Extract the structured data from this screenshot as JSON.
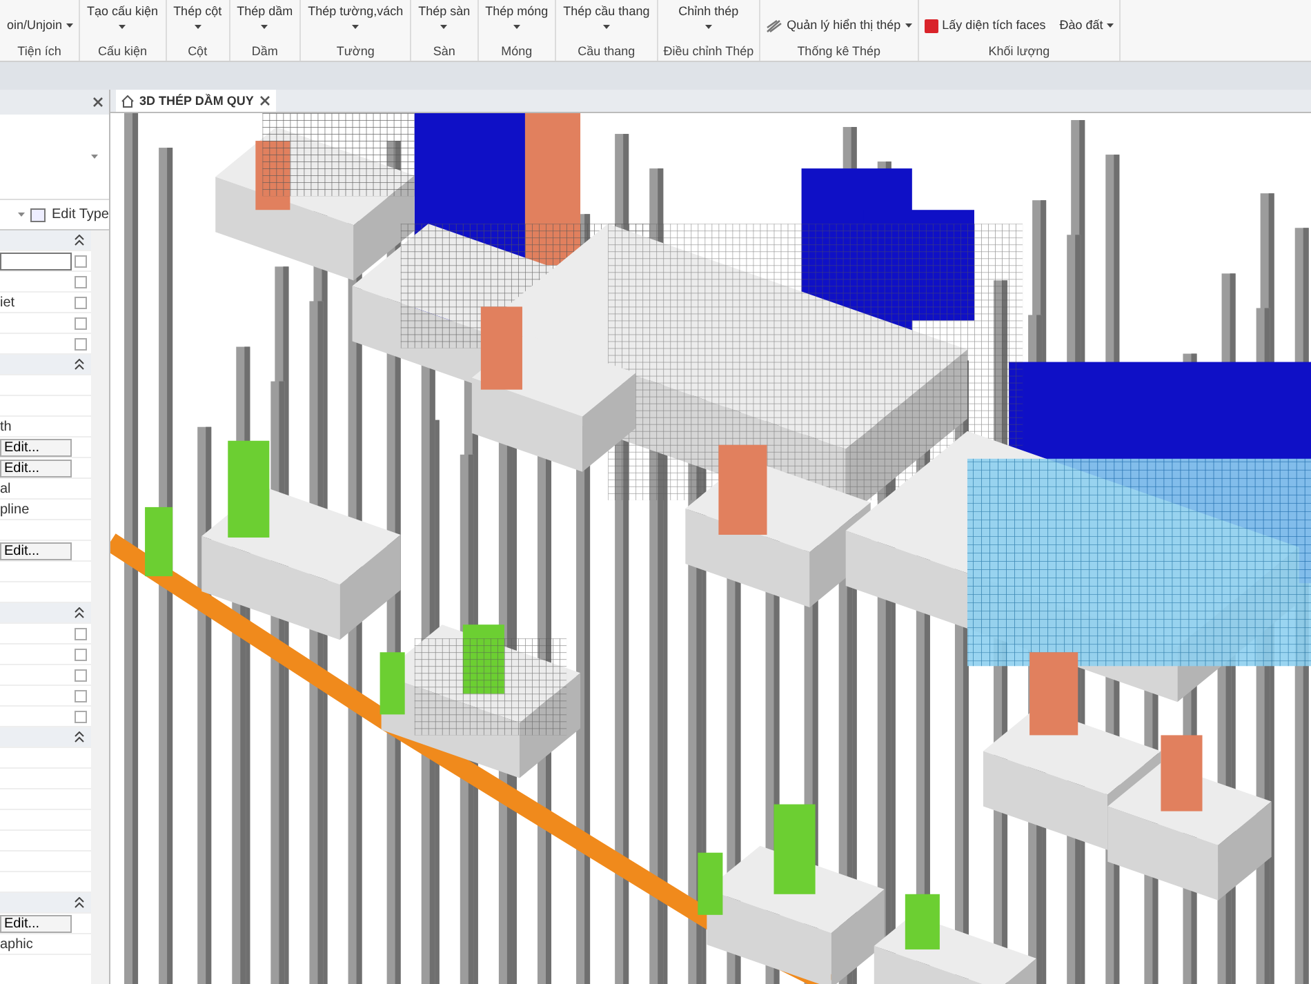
{
  "ribbon": {
    "groups": [
      {
        "label": "Tiện ích",
        "items": [
          {
            "kind": "plain",
            "text": "oin/Unjoin",
            "dropdown": true
          }
        ]
      },
      {
        "label": "Cấu kiện",
        "items": [
          {
            "kind": "large",
            "text": "Tạo cấu kiện",
            "dropdown": true
          }
        ]
      },
      {
        "label": "Cột",
        "items": [
          {
            "kind": "large",
            "text": "Thép cột",
            "dropdown": true
          }
        ]
      },
      {
        "label": "Dầm",
        "items": [
          {
            "kind": "large",
            "text": "Thép dầm",
            "dropdown": true
          }
        ]
      },
      {
        "label": "Tường",
        "items": [
          {
            "kind": "large",
            "text": "Thép tường,vách",
            "dropdown": true
          }
        ]
      },
      {
        "label": "Sàn",
        "items": [
          {
            "kind": "large",
            "text": "Thép sàn",
            "dropdown": true
          }
        ]
      },
      {
        "label": "Móng",
        "items": [
          {
            "kind": "large",
            "text": "Thép móng",
            "dropdown": true
          }
        ]
      },
      {
        "label": "Cầu thang",
        "items": [
          {
            "kind": "large",
            "text": "Thép cầu thang",
            "dropdown": true
          }
        ]
      },
      {
        "label": "Điều chỉnh Thép",
        "items": [
          {
            "kind": "large",
            "text": "Chỉnh thép",
            "dropdown": true
          }
        ]
      },
      {
        "label": "Thống kê Thép",
        "items": [
          {
            "kind": "tool",
            "text": "Quản lý hiển thị thép",
            "dropdown": true
          }
        ]
      },
      {
        "label": "Khối lượng",
        "items": [
          {
            "kind": "app",
            "text": "Lấy diện tích faces",
            "dropdown": false
          },
          {
            "kind": "plain",
            "text": "Đào đất",
            "dropdown": true
          }
        ]
      }
    ]
  },
  "properties": {
    "edit_type": "Edit Type",
    "rows": [
      {
        "kind": "section"
      },
      {
        "kind": "box",
        "checked": false
      },
      {
        "kind": "blank",
        "checked": false
      },
      {
        "kind": "text",
        "text": "iet",
        "checked": false
      },
      {
        "kind": "blank",
        "checked": false
      },
      {
        "kind": "blank",
        "checked": false
      },
      {
        "kind": "section"
      },
      {
        "kind": "blank"
      },
      {
        "kind": "blank"
      },
      {
        "kind": "text",
        "text": "th"
      },
      {
        "kind": "edit",
        "text": "Edit..."
      },
      {
        "kind": "edit",
        "text": "Edit..."
      },
      {
        "kind": "text",
        "text": "al"
      },
      {
        "kind": "text",
        "text": "pline"
      },
      {
        "kind": "blank"
      },
      {
        "kind": "edit",
        "text": "Edit..."
      },
      {
        "kind": "blank"
      },
      {
        "kind": "blank"
      },
      {
        "kind": "section"
      },
      {
        "kind": "blank",
        "checked": false
      },
      {
        "kind": "blank",
        "checked": false
      },
      {
        "kind": "blank",
        "checked": false
      },
      {
        "kind": "blank",
        "checked": false
      },
      {
        "kind": "blank",
        "checked": false
      },
      {
        "kind": "section"
      },
      {
        "kind": "blank"
      },
      {
        "kind": "blank"
      },
      {
        "kind": "blank"
      },
      {
        "kind": "blank"
      },
      {
        "kind": "blank"
      },
      {
        "kind": "blank"
      },
      {
        "kind": "blank"
      },
      {
        "kind": "section"
      },
      {
        "kind": "edit",
        "text": "Edit..."
      },
      {
        "kind": "text",
        "text": "aphic"
      }
    ]
  },
  "view_tab": {
    "title": "3D THÉP DẦM QUY"
  }
}
